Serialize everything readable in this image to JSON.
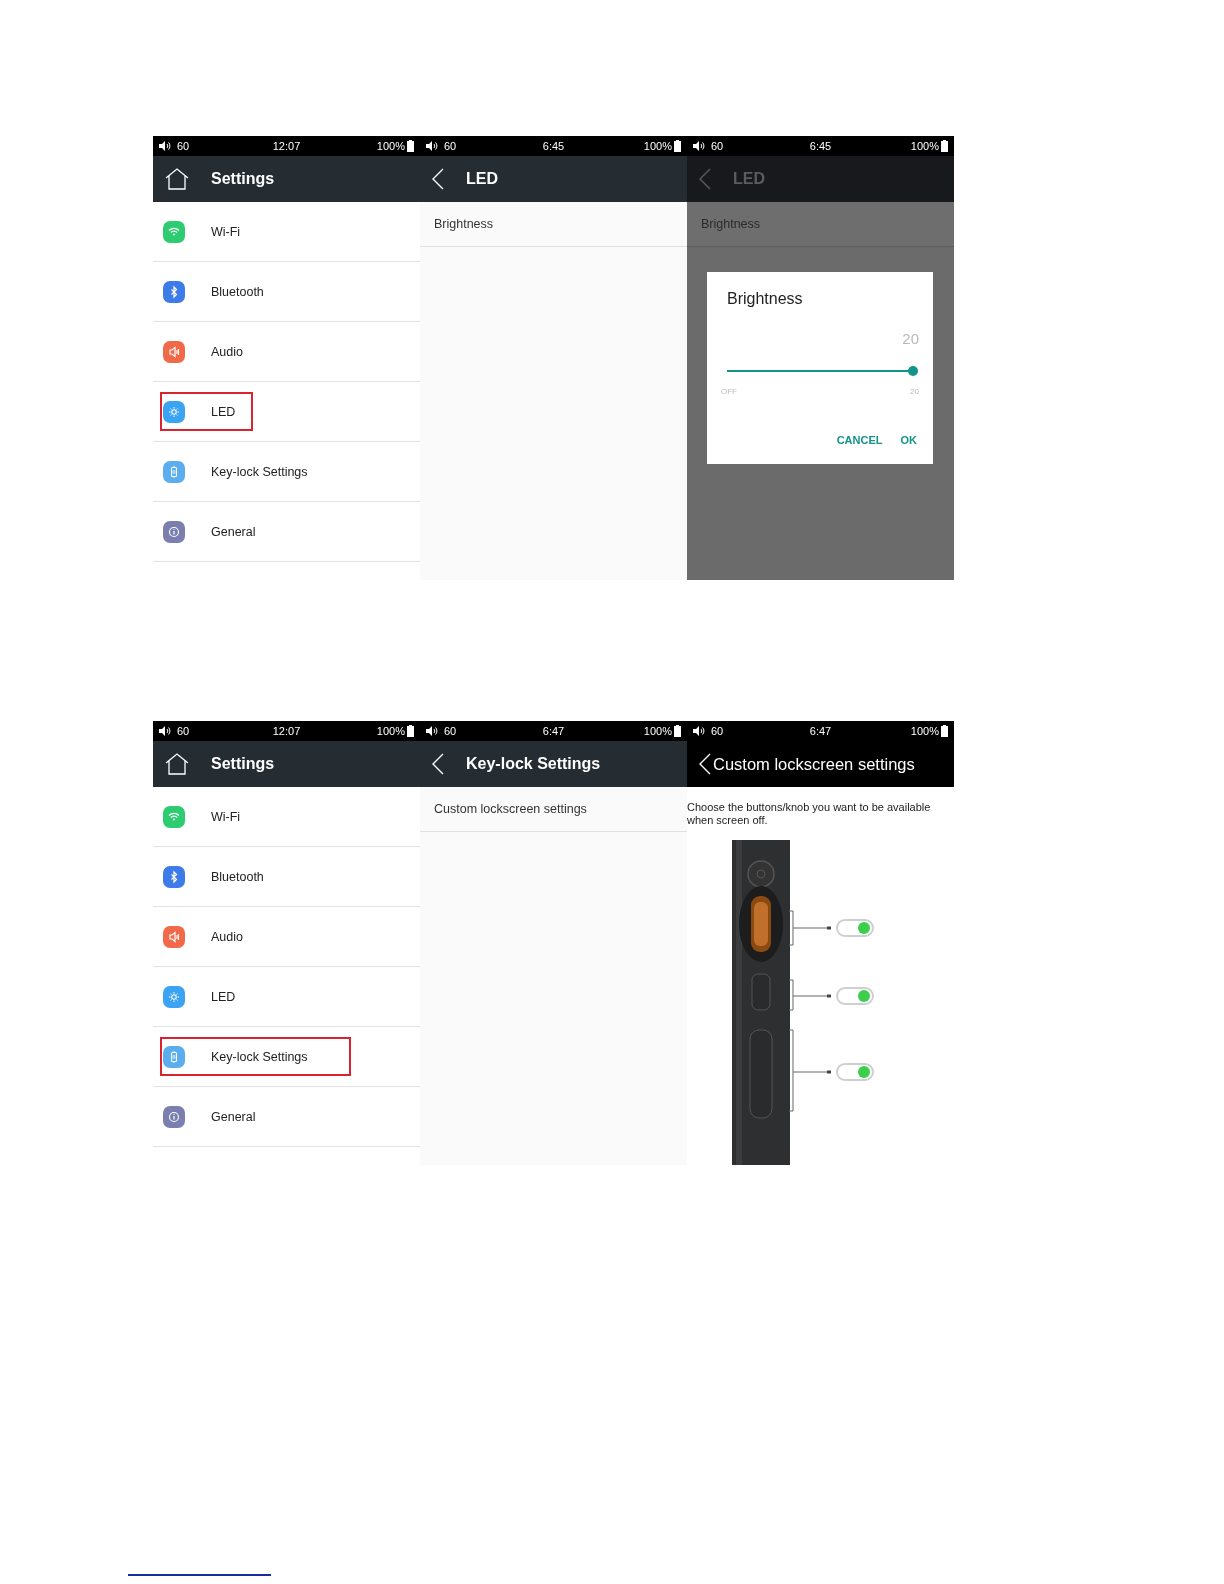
{
  "rows": [
    {
      "panels": [
        {
          "kind": "settings_list",
          "status": {
            "volume": "60",
            "time": "12:07",
            "battery": "100%"
          },
          "header": {
            "kind": "home",
            "title": "Settings"
          },
          "items": [
            {
              "label": "Wi-Fi",
              "color": "#2ecc71",
              "highlighted": false
            },
            {
              "label": "Bluetooth",
              "color": "#3d7be8",
              "highlighted": false
            },
            {
              "label": "Audio",
              "color": "#f06a4a",
              "highlighted": false
            },
            {
              "label": "LED",
              "color": "#3aa3f2",
              "highlighted": true
            },
            {
              "label": "Key-lock Settings",
              "color": "#5aaef0",
              "highlighted": false
            },
            {
              "label": "General",
              "color": "#7a7fb0",
              "highlighted": false
            }
          ]
        },
        {
          "kind": "submenu",
          "status": {
            "volume": "60",
            "time": "6:45",
            "battery": "100%"
          },
          "header": {
            "kind": "back",
            "title": "LED"
          },
          "items": [
            "Brightness"
          ]
        },
        {
          "kind": "dialog",
          "status": {
            "volume": "60",
            "time": "6:45",
            "battery": "100%"
          },
          "header": {
            "kind": "back",
            "title": "LED"
          },
          "items": [
            "Brightness"
          ],
          "dialog": {
            "title": "Brightness",
            "value": "20",
            "level": 1,
            "min_label": "OFF",
            "max_label": "20",
            "buttons": [
              "CANCEL",
              "OK"
            ]
          }
        }
      ]
    },
    {
      "panels": [
        {
          "kind": "settings_list",
          "status": {
            "volume": "60",
            "time": "12:07",
            "battery": "100%"
          },
          "header": {
            "kind": "home",
            "title": "Settings"
          },
          "items": [
            {
              "label": "Wi-Fi",
              "color": "#2ecc71",
              "highlighted": false
            },
            {
              "label": "Bluetooth",
              "color": "#3d7be8",
              "highlighted": false
            },
            {
              "label": "Audio",
              "color": "#f06a4a",
              "highlighted": false
            },
            {
              "label": "LED",
              "color": "#3aa3f2",
              "highlighted": false
            },
            {
              "label": "Key-lock Settings",
              "color": "#5aaef0",
              "highlighted": true
            },
            {
              "label": "General",
              "color": "#7a7fb0",
              "highlighted": false
            }
          ]
        },
        {
          "kind": "submenu",
          "status": {
            "volume": "60",
            "time": "6:47",
            "battery": "100%"
          },
          "header": {
            "kind": "back",
            "title": "Key-lock Settings"
          },
          "items": [
            "Custom lockscreen settings"
          ]
        },
        {
          "kind": "lockscreen",
          "status": {
            "volume": "60",
            "time": "6:47",
            "battery": "100%"
          },
          "header": {
            "kind": "back",
            "title": "Custom lockscreen settings"
          },
          "description": "Choose the buttons/knob you want to be available when screen off.",
          "toggles": [
            {
              "on": true
            },
            {
              "on": true
            },
            {
              "on": true
            }
          ]
        }
      ]
    }
  ]
}
